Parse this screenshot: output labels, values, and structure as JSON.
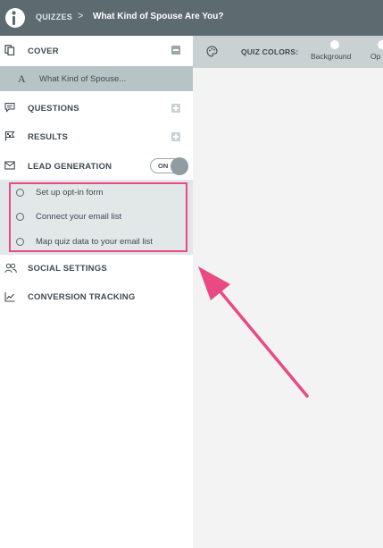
{
  "header": {
    "breadcrumb_root": "QUIZZES",
    "breadcrumb_separator": ">",
    "quiz_title": "What Kind of Spouse Are You?"
  },
  "sidebar": {
    "cover": {
      "label": "COVER",
      "item_letter": "A",
      "item_title": "What Kind of Spouse..."
    },
    "questions": {
      "label": "QUESTIONS"
    },
    "results": {
      "label": "RESULTS"
    },
    "lead_generation": {
      "label": "LEAD GENERATION",
      "toggle_label": "ON",
      "items": [
        {
          "label": "Set up opt-in form"
        },
        {
          "label": "Connect your email list"
        },
        {
          "label": "Map quiz data to your email list"
        }
      ]
    },
    "social_settings": {
      "label": "SOCIAL SETTINGS"
    },
    "conversion_tracking": {
      "label": "CONVERSION TRACKING"
    }
  },
  "toolbar": {
    "label": "QUIZ COLORS:",
    "options": [
      {
        "label": "Background"
      },
      {
        "label": "Op"
      }
    ]
  },
  "colors": {
    "header_bg": "#5d6b71",
    "selected_item_bg": "#b7c4c6",
    "lead_block_bg": "#e2e7e8",
    "highlight": "#e94a84"
  }
}
